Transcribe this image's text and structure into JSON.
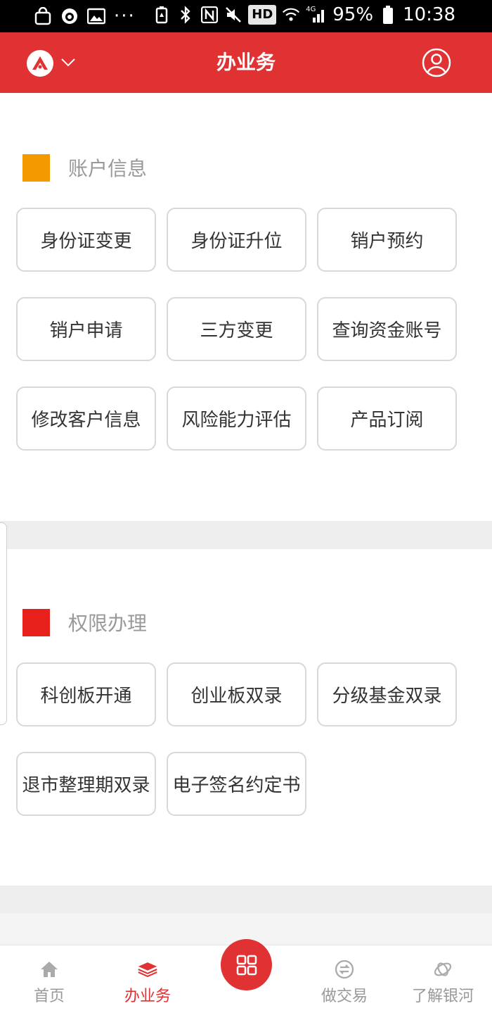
{
  "status_bar": {
    "hd": "HD",
    "signal_label": "4G",
    "battery": "95%",
    "time": "10:38"
  },
  "header": {
    "title": "办业务"
  },
  "sections": [
    {
      "title": "账户信息",
      "marker_color": "#f29a00",
      "buttons": [
        "身份证变更",
        "身份证升位",
        "销户预约",
        "销户申请",
        "三方变更",
        "查询资金账号",
        "修改客户信息",
        "风险能力评估",
        "产品订阅"
      ]
    },
    {
      "title": "权限办理",
      "marker_color": "#e8211c",
      "buttons": [
        "科创板开通",
        "创业板双录",
        "分级基金双录",
        "退市整理期双录",
        "电子签名约定书"
      ]
    }
  ],
  "tabs": [
    {
      "label": "首页",
      "icon": "home-icon"
    },
    {
      "label": "办业务",
      "icon": "layers-icon",
      "active": true
    },
    {
      "label": "",
      "icon": "grid-icon"
    },
    {
      "label": "做交易",
      "icon": "exchange-icon"
    },
    {
      "label": "了解银河",
      "icon": "galaxy-icon"
    }
  ],
  "colors": {
    "brand": "#e03133",
    "inactive": "#999999"
  }
}
